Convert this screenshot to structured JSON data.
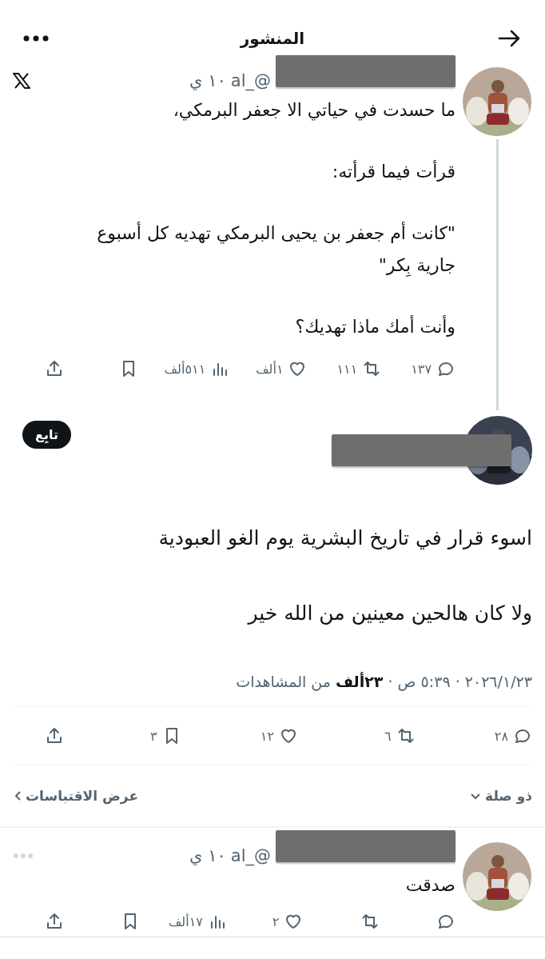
{
  "header": {
    "title": "المنشور"
  },
  "posts": [
    {
      "kind": "thread",
      "author": {
        "redacted": true,
        "handle": "@_al",
        "time": "١٠ ي"
      },
      "body": [
        "ما حسدت في حياتي الا جعفر البرمكي،",
        "قرأت فيما قرأته:",
        "\"كانت أم جعفر بن يحيى البرمكي تهديه كل أسبوع جارية بِكر\"",
        "وأنت أمك ماذا تهديك؟"
      ],
      "actions": [
        {
          "kind": "reply",
          "count": "١٣٧"
        },
        {
          "kind": "repost",
          "count": "١١١"
        },
        {
          "kind": "like",
          "count": "١ألف"
        },
        {
          "kind": "views",
          "count": "٥١١ألف"
        },
        {
          "kind": "bookmark"
        },
        {
          "kind": "share"
        }
      ]
    },
    {
      "kind": "main",
      "author": {
        "redacted": true
      },
      "follow_button": "تابِع",
      "body": [
        "اسوء قرار في تاريخ البشرية يوم الغو العبودية",
        "ولا كان هالحين معينين من الله خير"
      ],
      "timestamp": "٢٠٢٦/١/٢٣ · ٥:٣٩ ص · **٢٣ألف** من المشاهدات",
      "actions": [
        {
          "kind": "reply",
          "count": "٢٨"
        },
        {
          "kind": "repost",
          "count": "٦"
        },
        {
          "kind": "like",
          "count": "١٢"
        },
        {
          "kind": "bookmark",
          "count": "٣"
        },
        {
          "kind": "share"
        }
      ],
      "related": "ذو صلة",
      "quotes": "عرض الاقتباسات"
    },
    {
      "kind": "reply",
      "author": {
        "redacted": true,
        "handle": "@_al",
        "time": "١٠ ي"
      },
      "body": [
        "صدقت"
      ],
      "actions": [
        {
          "kind": "reply"
        },
        {
          "kind": "repost"
        },
        {
          "kind": "like",
          "count": "٢"
        },
        {
          "kind": "views",
          "count": "١٧ألف"
        },
        {
          "kind": "bookmark"
        },
        {
          "kind": "share"
        }
      ]
    }
  ]
}
